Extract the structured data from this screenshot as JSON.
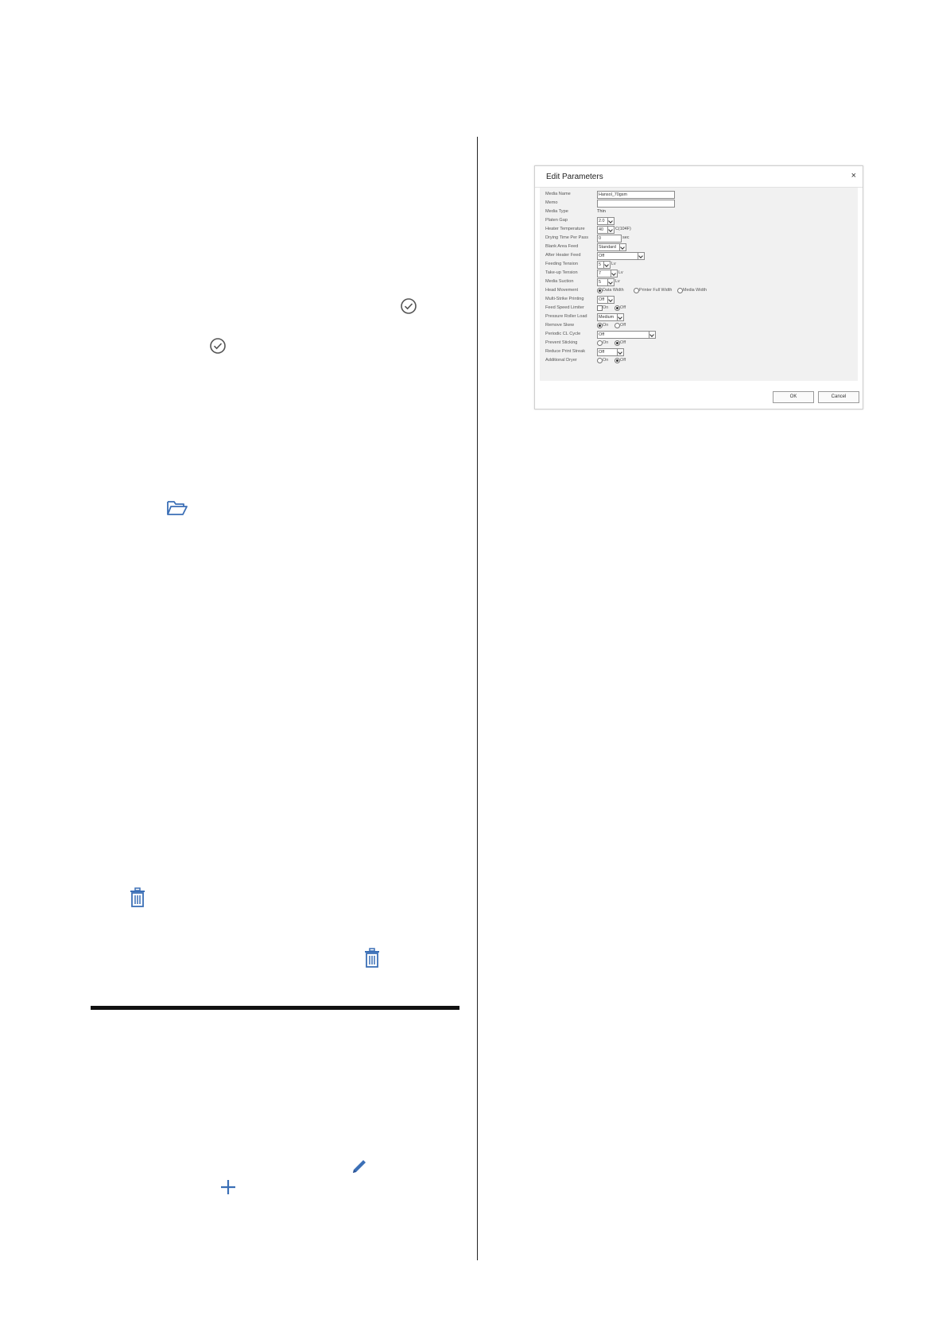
{
  "dialog": {
    "title": "Edit Parameters",
    "close_glyph": "×",
    "fields": {
      "media_name": {
        "label": "Media Name",
        "value": "Hansol_70gsm"
      },
      "memo": {
        "label": "Memo",
        "value": ""
      },
      "media_type": {
        "label": "Media Type",
        "value": "Thin"
      },
      "platen_gap": {
        "label": "Platen Gap",
        "value": "2.0"
      },
      "heater_temperature": {
        "label": "Heater Temperature",
        "value": "40",
        "unit": "C(104F)"
      },
      "drying_time": {
        "label": "Drying Time Per Pass",
        "value": "0",
        "unit": "sec"
      },
      "blank_area_feed": {
        "label": "Blank Area Feed",
        "value": "Standard"
      },
      "after_heater_feed": {
        "label": "After Heater Feed",
        "value": "Off"
      },
      "feeding_tension": {
        "label": "Feeding Tension",
        "value": "5",
        "unit": "Lv"
      },
      "takeup_tension": {
        "label": "Take-up Tension",
        "value": "7",
        "unit": "Lv"
      },
      "media_suction": {
        "label": "Media Suction",
        "value": "5",
        "unit": "Lv"
      },
      "head_movement": {
        "label": "Head Movement",
        "options": [
          "Data Width",
          "Printer Full Width",
          "Media Width"
        ],
        "selected": "Data Width"
      },
      "multi_strike_printing": {
        "label": "Multi-Strike Printing",
        "value": "Off"
      },
      "feed_speed_limiter": {
        "label": "Feed Speed Limiter",
        "options": [
          "On",
          "Off"
        ],
        "selected": "Off"
      },
      "pressure_roller_load": {
        "label": "Pressure Roller Load",
        "value": "Medium"
      },
      "remove_skew": {
        "label": "Remove Skew",
        "options": [
          "On",
          "Off"
        ],
        "selected": "On"
      },
      "periodic_cl_cycle": {
        "label": "Periodic CL Cycle",
        "value": "Off"
      },
      "prevent_sticking": {
        "label": "Prevent Sticking",
        "options": [
          "On",
          "Off"
        ],
        "selected": "Off"
      },
      "reduce_print_streak": {
        "label": "Reduce Print Streak",
        "value": "Off"
      },
      "additional_dryer": {
        "label": "Additional Dryer",
        "options": [
          "On",
          "Off"
        ],
        "selected": "Off"
      }
    },
    "ok_label": "OK",
    "cancel_label": "Cancel"
  },
  "icons": [
    "check-circle-icon",
    "check-circle-icon",
    "folder-icon",
    "trash-icon",
    "trash-icon",
    "pencil-icon",
    "plus-icon"
  ],
  "colors": {
    "accent_icon": "#3b6fb6",
    "check_icon": "#555555"
  }
}
